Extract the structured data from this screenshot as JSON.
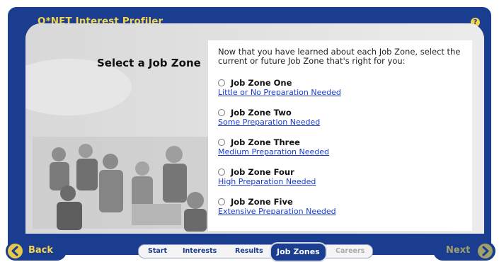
{
  "app": {
    "title": "O*NET Interest Profiler",
    "help_glyph": "?"
  },
  "page": {
    "heading": "Select a Job Zone",
    "intro": "Now that you have learned about each Job Zone, select the current or future Job Zone that's right for you:"
  },
  "zones": [
    {
      "label": "Job Zone One",
      "link": "Little or No Preparation Needed",
      "selected": false
    },
    {
      "label": "Job Zone Two",
      "link": "Some Preparation Needed",
      "selected": false
    },
    {
      "label": "Job Zone Three",
      "link": "Medium Preparation Needed",
      "selected": false
    },
    {
      "label": "Job Zone Four",
      "link": "High Preparation Needed",
      "selected": false
    },
    {
      "label": "Job Zone Five",
      "link": "Extensive Preparation Needed",
      "selected": false
    }
  ],
  "nav": {
    "back_label": "Back",
    "next_label": "Next",
    "tabs": [
      {
        "label": "Start",
        "state": "normal"
      },
      {
        "label": "Interests",
        "state": "normal"
      },
      {
        "label": "Results",
        "state": "normal"
      },
      {
        "label": "Job Zones",
        "state": "active"
      },
      {
        "label": "Careers",
        "state": "disabled"
      }
    ]
  },
  "colors": {
    "frame": "#1b3d8f",
    "title": "#f3d54e",
    "link": "#1a3ccc",
    "content_bg": "#e3e3e3"
  },
  "icons": {
    "help": "help-icon",
    "back": "arrow-left-icon",
    "next": "arrow-right-icon"
  }
}
